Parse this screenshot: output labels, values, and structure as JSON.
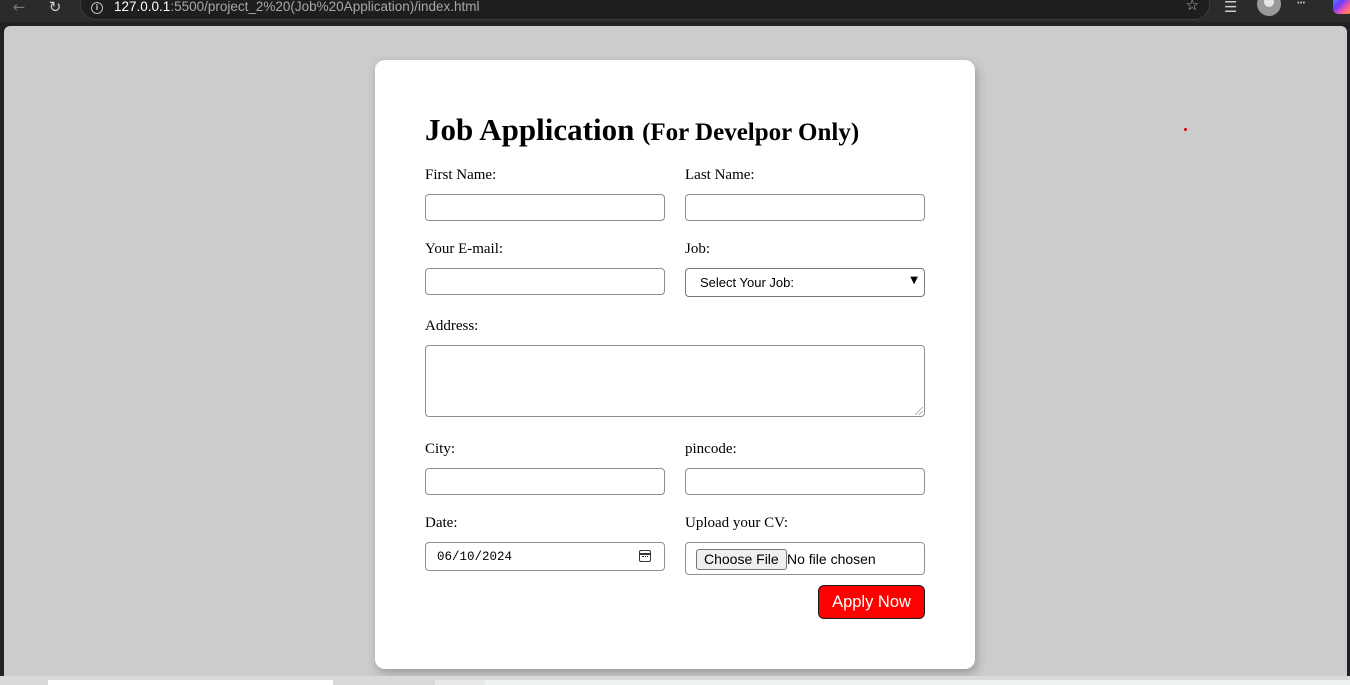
{
  "browser": {
    "url_host": "127.0.0.1",
    "url_rest": ":5500/project_2%20(Job%20Application)/index.html",
    "icons": [
      "back-arrow-icon",
      "reload-icon",
      "info-icon",
      "star-icon",
      "reading-list-icon",
      "profile-avatar-icon",
      "more-menu-icon",
      "copilot-icon"
    ],
    "glyphs": {
      "back": "←",
      "reload": "↻",
      "info": "i",
      "star": "☆",
      "reading_list": "☰",
      "more": "···"
    }
  },
  "form": {
    "title": "Job Application",
    "subtitle": "(For Develpor Only)",
    "first_name_label": "First Name:",
    "last_name_label": "Last Name:",
    "email_label": "Your E-mail:",
    "job_label": "Job:",
    "job_selected": "Select Your Job:",
    "address_label": "Address:",
    "city_label": "City:",
    "pincode_label": "pincode:",
    "date_label": "Date:",
    "date_value": "06/10/2024",
    "cv_label": "Upload your CV:",
    "choose_file": "Choose File",
    "file_status": "No file chosen",
    "submit_label": "Apply Now"
  },
  "colors": {
    "page_background": "#cccccc",
    "card_background": "#ffffff",
    "button_red": "#ff0000",
    "button_text": "#ffffff"
  }
}
